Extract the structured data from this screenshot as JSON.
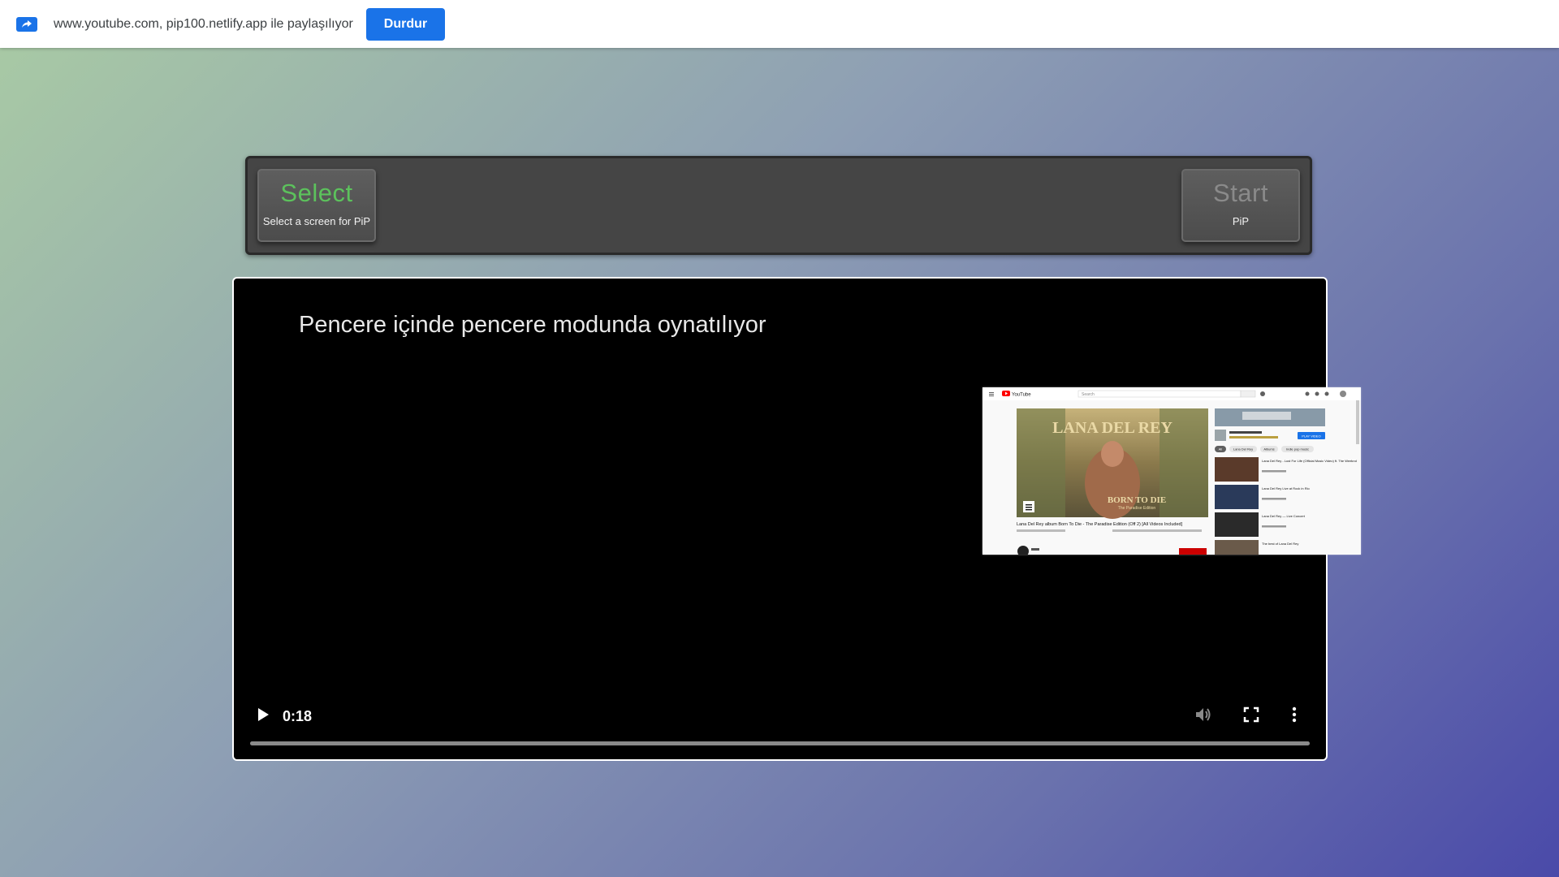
{
  "share_bar": {
    "text": "www.youtube.com, pip100.netlify.app ile paylaşılıyor",
    "stop_label": "Durdur",
    "icon": "screen-share-icon",
    "accent": "#1a73e8"
  },
  "panel": {
    "select": {
      "title": "Select",
      "subtitle": "Select a screen for PiP"
    },
    "start": {
      "title": "Start",
      "subtitle": "PiP"
    }
  },
  "video": {
    "overlay_text": "Pencere içinde pencere modunda oynatılıyor",
    "time": "0:18",
    "progress": 1.0,
    "pip_preview": {
      "logo": "YouTube",
      "search_placeholder": "Search",
      "album_top": "LANA DEL REY",
      "album_bottom": "BORN TO DIE",
      "album_sub": "The Paradise Edition",
      "video_title": "Lana Del Rey album Born To Die - The Paradise Edition (Off 2) [All Videos Included]",
      "play_button": "PLAY VIDEO",
      "chips": [
        "All",
        "Lana Del Rey",
        "Albums",
        "Indie pop music"
      ],
      "side_items": [
        "Lana Del Rey - Lust For Life (Official Music Video) ft. The Weeknd",
        "Lana Del Rey Live at Rock in Rio",
        "Lana Del Rey — Live Concert",
        "The best of Lana Del Rey"
      ]
    },
    "icons": [
      "play-icon",
      "volume-icon",
      "fullscreen-icon",
      "more-icon"
    ]
  }
}
